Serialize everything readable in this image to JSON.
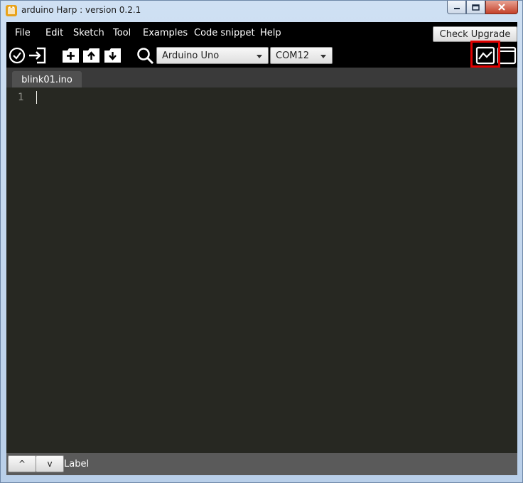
{
  "window": {
    "title": "arduino Harp : version 0.2.1"
  },
  "menubar": {
    "items": [
      "File",
      "Edit",
      "Sketch",
      "Tool",
      "Examples",
      "Code snippet",
      "Help"
    ],
    "check_upgrade_label": "Check Upgrade"
  },
  "toolbar": {
    "board_select": "Arduino Uno",
    "port_select": "COM12",
    "icons": [
      "verify-icon",
      "upload-icon",
      "new-file-icon",
      "open-file-icon",
      "save-file-icon",
      "search-icon",
      "serial-plotter-icon",
      "serial-monitor-icon"
    ]
  },
  "editor": {
    "tab_label": "blink01.ino",
    "line_numbers": [
      "1"
    ]
  },
  "statusbar": {
    "up_label": "^",
    "down_label": "v",
    "label": "Label"
  },
  "colors": {
    "editor_bg": "#272822",
    "toolbar_bg": "#000000",
    "highlight": "#e00000"
  }
}
